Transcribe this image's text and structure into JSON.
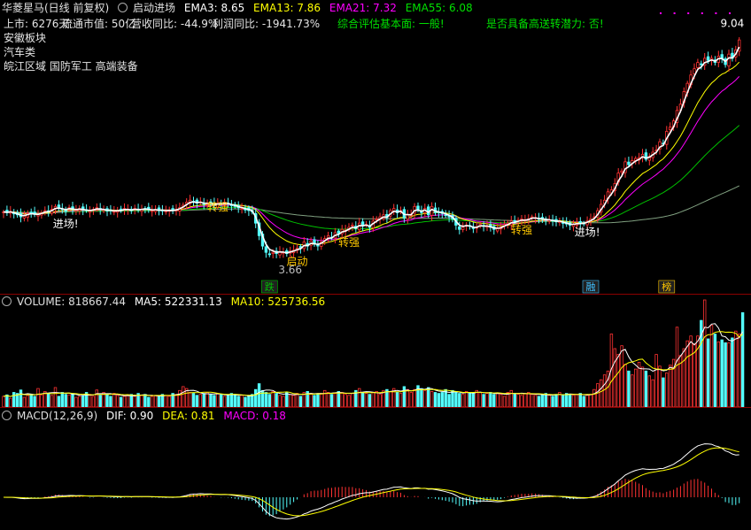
{
  "header": {
    "stock_name": "华菱星马(日线 前复权)",
    "indicator_name": "启动进场",
    "ema3": "EMA3: 8.65",
    "ema13": "EMA13: 7.86",
    "ema21": "EMA21: 7.32",
    "ema55": "EMA55: 6.08"
  },
  "info": {
    "listing": "上市: 6276天",
    "circ_value": "流通市值: 50亿",
    "revenue_yoy": "营收同比: -44.9%",
    "profit_yoy": "利润同比: -1941.73%",
    "fundamental": "综合评估基本面: 一般!",
    "bonus_potential": "是否具备高送转潜力: 否!",
    "sector": "安徽板块",
    "industry": "汽车类",
    "concepts": "皖江区域 国防军工 高端装备"
  },
  "volume_header": {
    "volume": "VOLUME: 818667.44",
    "ma5": "MA5: 522331.13",
    "ma10": "MA10: 525736.56"
  },
  "macd_header": {
    "name": "MACD(12,26,9)",
    "dif": "DIF: 0.90",
    "dea": "DEA: 0.81",
    "macd": "MACD: 0.18"
  },
  "colors": {
    "up": "#ff3232",
    "down": "#54ffff",
    "ema3": "#ffffff",
    "ema13": "#ffff00",
    "ema21": "#ff00ff",
    "ema55": "#00c000",
    "long_ma": "#80a080",
    "label_gold": "#ffc800",
    "label_white": "#ffffff",
    "divider": "#8b0000"
  },
  "chart_data": {
    "type": "candlestick",
    "price_ylim": [
      3,
      9.7
    ],
    "price_series": {
      "close": [
        4.92,
        4.9,
        4.93,
        4.88,
        4.85,
        4.8,
        4.82,
        4.88,
        4.9,
        4.86,
        4.85,
        4.9,
        4.95,
        4.93,
        4.98,
        5.05,
        5.02,
        4.98,
        4.95,
        5.02,
        4.98,
        4.96,
        5.0,
        4.97,
        4.95,
        4.94,
        4.98,
        5.02,
        4.98,
        4.97,
        4.94,
        4.96,
        4.93,
        4.95,
        4.96,
        5.0,
        4.98,
        4.95,
        5.0,
        4.97,
        4.98,
        5.0,
        4.97,
        4.95,
        4.98,
        4.95,
        4.96,
        4.94,
        4.96,
        4.95,
        4.98,
        5.02,
        5.08,
        5.15,
        5.2,
        5.17,
        5.13,
        5.16,
        5.11,
        5.12,
        5.14,
        5.07,
        5.12,
        5.1,
        5.15,
        5.12,
        5.07,
        5.05,
        5.02,
        5.0,
        4.98,
        4.95,
        4.92,
        4.65,
        4.35,
        4.1,
        3.95,
        3.9,
        3.95,
        3.92,
        3.97,
        3.95,
        3.92,
        3.98,
        4.0,
        4.05,
        4.05,
        4.2,
        4.1,
        4.22,
        4.15,
        4.12,
        4.2,
        4.28,
        4.35,
        4.3,
        4.42,
        4.4,
        4.5,
        4.48,
        4.55,
        4.6,
        4.52,
        4.65,
        4.58,
        4.62,
        4.55,
        4.7,
        4.75,
        4.8,
        4.85,
        4.78,
        4.95,
        5.0,
        4.9,
        4.95,
        4.78,
        4.85,
        4.85,
        5.05,
        4.98,
        4.9,
        5.0,
        4.85,
        5.05,
        4.9,
        4.9,
        4.88,
        4.85,
        4.8,
        4.75,
        4.6,
        4.5,
        4.55,
        4.6,
        4.58,
        4.52,
        4.55,
        4.62,
        4.58,
        4.58,
        4.55,
        4.5,
        4.52,
        4.55,
        4.62,
        4.65,
        4.7,
        4.68,
        4.72,
        4.75,
        4.72,
        4.75,
        4.8,
        4.78,
        4.75,
        4.74,
        4.73,
        4.72,
        4.7,
        4.68,
        4.7,
        4.65,
        4.63,
        4.6,
        4.62,
        4.65,
        4.64,
        4.65,
        4.7,
        4.75,
        4.8,
        4.95,
        5.1,
        5.2,
        5.4,
        5.45,
        5.6,
        5.85,
        5.9,
        6.12,
        6.05,
        6.15,
        6.2,
        6.22,
        6.3,
        6.18,
        6.25,
        6.35,
        6.4,
        6.6,
        6.55,
        6.85,
        6.95,
        7.1,
        7.35,
        7.5,
        7.8,
        8.0,
        8.2,
        8.35,
        8.5,
        8.45,
        8.6,
        8.55,
        8.6,
        8.5,
        8.65,
        8.6,
        8.45,
        8.7,
        8.6,
        8.8,
        9.04
      ],
      "ema3_last": 8.65,
      "ema13_last": 7.86,
      "ema21_last": 7.32,
      "ema55_last": 6.08
    },
    "volume_series": {
      "values": [
        22,
        25,
        18,
        30,
        28,
        35,
        20,
        24,
        26,
        22,
        38,
        25,
        32,
        28,
        24,
        40,
        22,
        30,
        26,
        25,
        28,
        20,
        22,
        24,
        30,
        26,
        22,
        35,
        24,
        30,
        26,
        22,
        28,
        24,
        20,
        22,
        24,
        26,
        22,
        28,
        24,
        26,
        20,
        22,
        24,
        22,
        26,
        24,
        22,
        28,
        26,
        34,
        42,
        38,
        30,
        28,
        24,
        26,
        28,
        30,
        26,
        24,
        28,
        26,
        22,
        24,
        28,
        26,
        22,
        24,
        20,
        22,
        26,
        36,
        48,
        34,
        30,
        26,
        32,
        28,
        24,
        22,
        30,
        26,
        24,
        28,
        22,
        30,
        32,
        28,
        24,
        26,
        28,
        34,
        30,
        26,
        28,
        32,
        30,
        26,
        24,
        28,
        34,
        38,
        30,
        28,
        26,
        30,
        32,
        26,
        34,
        36,
        32,
        38,
        30,
        28,
        42,
        36,
        30,
        36,
        44,
        38,
        34,
        40,
        32,
        30,
        28,
        30,
        36,
        26,
        34,
        30,
        28,
        26,
        32,
        30,
        28,
        34,
        30,
        26,
        28,
        30,
        26,
        28,
        26,
        22,
        30,
        34,
        28,
        26,
        24,
        28,
        30,
        26,
        24,
        22,
        26,
        28,
        24,
        22,
        26,
        30,
        24,
        28,
        26,
        24,
        26,
        28,
        22,
        24,
        26,
        36,
        48,
        56,
        66,
        74,
        150,
        120,
        108,
        126,
        88,
        74,
        66,
        78,
        92,
        82,
        74,
        64,
        56,
        108,
        84,
        60,
        70,
        86,
        98,
        164,
        106,
        120,
        136,
        146,
        130,
        146,
        178,
        220,
        140,
        168,
        150,
        134,
        138,
        132,
        132,
        142,
        156,
        150,
        194
      ],
      "ma5_last": 522331.13,
      "ma10_last": 525736.56,
      "volume_last": 818667.44,
      "ylim": [
        0,
        200
      ]
    },
    "macd_series": {
      "dif_last": 0.9,
      "dea_last": 0.81,
      "macd_last": 0.18,
      "ylim": [
        -0.45,
        1.05
      ]
    },
    "annotations": [
      {
        "text": "进场!",
        "index": 18,
        "price": 4.55,
        "color": "white"
      },
      {
        "text": "转强",
        "index": 62,
        "price": 4.95,
        "color": "gold"
      },
      {
        "text": "启动",
        "index": 85,
        "price": 3.65,
        "color": "gold"
      },
      {
        "text": "3.66",
        "index": 83,
        "price": 3.45,
        "color": "gray"
      },
      {
        "text": "转强",
        "index": 100,
        "price": 4.1,
        "color": "gold"
      },
      {
        "text": "转强",
        "index": 150,
        "price": 4.4,
        "color": "gold"
      },
      {
        "text": "进场!",
        "index": 169,
        "price": 4.35,
        "color": "white"
      },
      {
        "text": "9.04",
        "index": 211,
        "price": 9.35,
        "color": "white"
      }
    ],
    "markers": [
      {
        "text": "跌",
        "index": 77,
        "color": "#00c000"
      },
      {
        "text": "融",
        "index": 170,
        "color": "#40c0ff"
      },
      {
        "text": "榜",
        "index": 192,
        "color": "#ffc800"
      }
    ]
  }
}
